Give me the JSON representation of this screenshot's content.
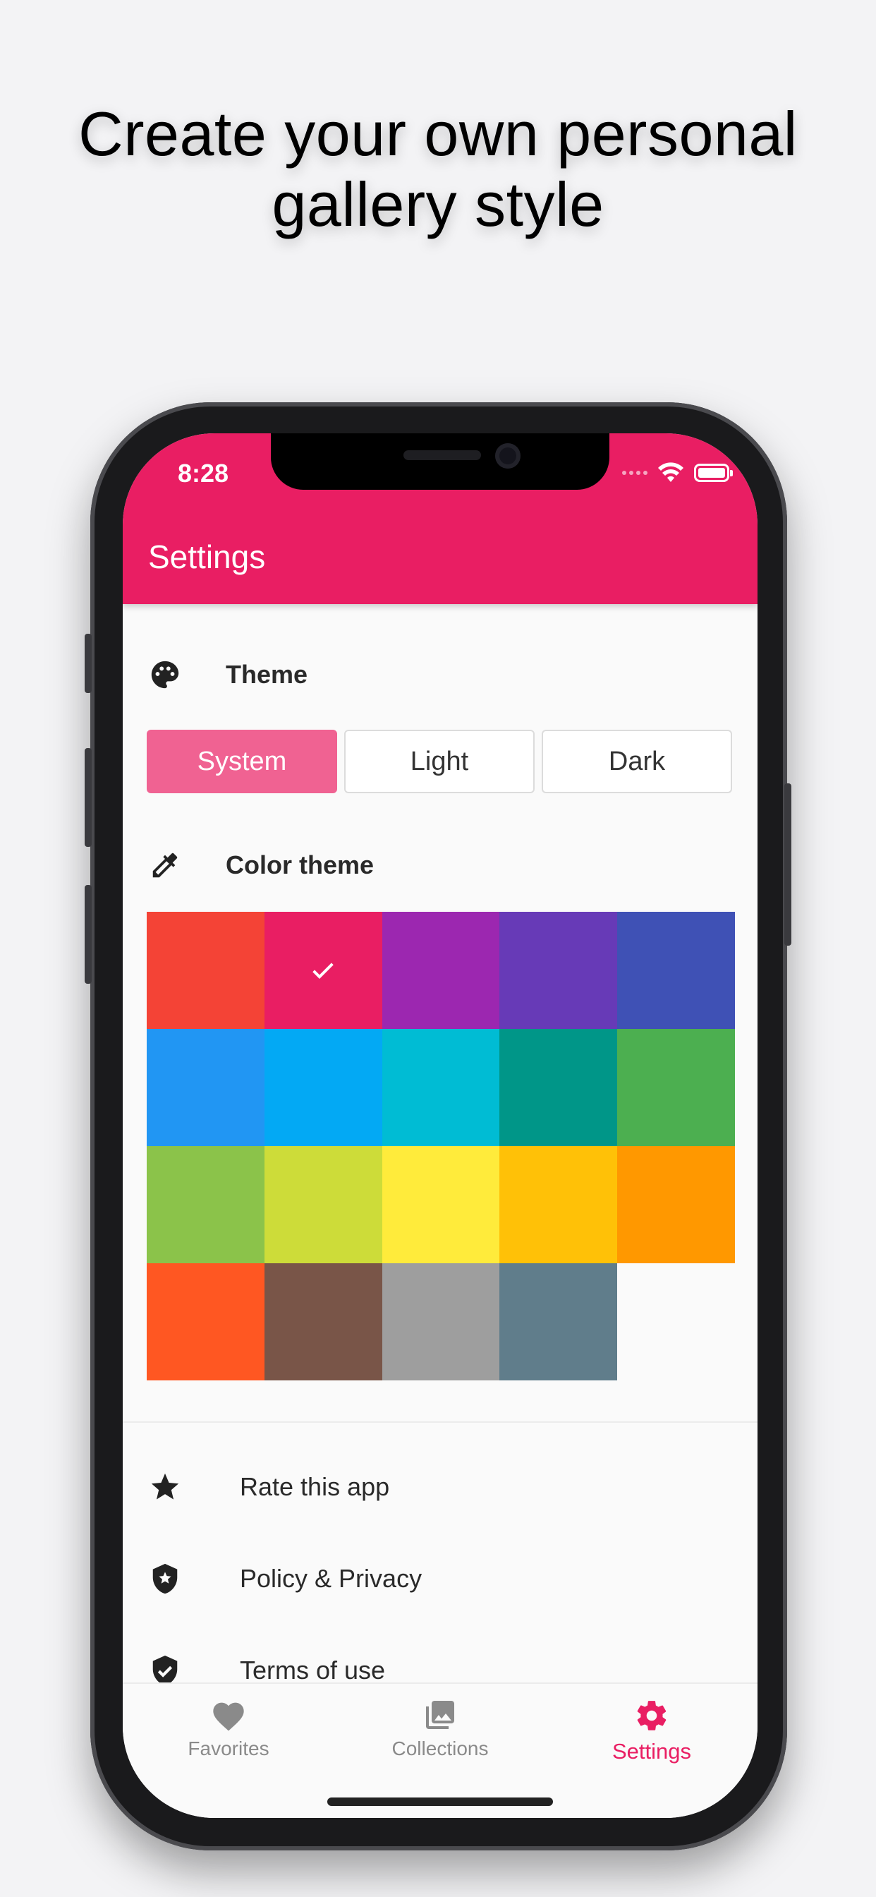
{
  "headline": {
    "line1": "Create your own personal",
    "line2": "gallery style"
  },
  "status_bar": {
    "time": "8:28",
    "icons": [
      "wifi-icon",
      "battery-icon"
    ]
  },
  "app_bar": {
    "title": "Settings"
  },
  "theme_section": {
    "label": "Theme",
    "icon": "palette-icon",
    "options": [
      "System",
      "Light",
      "Dark"
    ],
    "selected": "System"
  },
  "color_theme_section": {
    "label": "Color theme",
    "icon": "eyedropper-icon",
    "swatches": [
      "#f44336",
      "#e91e63",
      "#9c27b0",
      "#673ab7",
      "#3f51b5",
      "#2196f3",
      "#03a9f4",
      "#00bcd4",
      "#009688",
      "#4caf50",
      "#8bc34a",
      "#cddc39",
      "#ffeb3b",
      "#ffc107",
      "#ff9800",
      "#ff5722",
      "#795548",
      "#9e9e9e",
      "#607d8b"
    ],
    "selected_swatch": "#e91e63"
  },
  "list_items": [
    {
      "label": "Rate this app",
      "icon": "star-icon"
    },
    {
      "label": "Policy & Privacy",
      "icon": "shield-star-icon"
    },
    {
      "label": "Terms of use",
      "icon": "shield-check-icon"
    }
  ],
  "bottom_nav": {
    "items": [
      {
        "label": "Favorites",
        "icon": "heart-icon"
      },
      {
        "label": "Collections",
        "icon": "photo-library-icon"
      },
      {
        "label": "Settings",
        "icon": "gear-icon"
      }
    ],
    "active": "Settings"
  },
  "colors": {
    "primary": "#e91e63",
    "segment_active": "#f06292",
    "background": "#f3f3f5"
  }
}
